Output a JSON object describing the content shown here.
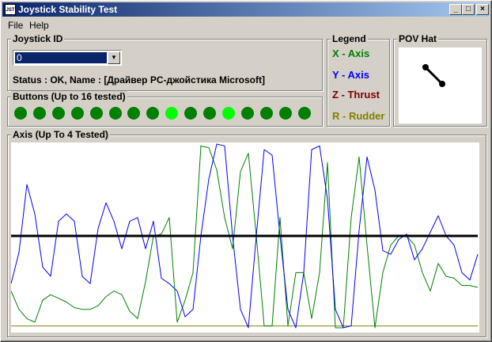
{
  "window": {
    "title": "Joystick Stability Test",
    "icon_text": "JST",
    "controls": {
      "minimize": "_",
      "maximize": "□",
      "close": "×"
    }
  },
  "menu": {
    "items": [
      "File",
      "Help"
    ]
  },
  "joystick": {
    "group_label": "Joystick ID",
    "selected_id": "0",
    "status": "Status : OK, Name : [Драйвер PC-джойстика Microsoft]"
  },
  "buttons": {
    "group_label": "Buttons  (Up to 16 tested)",
    "states": [
      false,
      false,
      false,
      false,
      false,
      false,
      false,
      false,
      true,
      false,
      false,
      true,
      false,
      false,
      false,
      false
    ],
    "colors": {
      "off": "#008000",
      "on": "#00ff00"
    }
  },
  "legend": {
    "group_label": "Legend",
    "items": [
      {
        "label": "X - Axis",
        "color": "#008000"
      },
      {
        "label": "Y - Axis",
        "color": "#0000ff"
      },
      {
        "label": "Z - Thrust",
        "color": "#800000"
      },
      {
        "label": "R - Rudder",
        "color": "#808000"
      }
    ]
  },
  "pov": {
    "group_label": "POV Hat",
    "direction": "northwest"
  },
  "axis": {
    "group_label": "Axis (Up To 4 Tested)"
  },
  "chart_data": {
    "type": "line",
    "title": "",
    "xlabel": "",
    "ylabel": "",
    "ylim": [
      0,
      1
    ],
    "x": [
      0,
      10,
      20,
      30,
      40,
      50,
      60,
      70,
      80,
      90,
      100,
      110,
      120,
      130,
      140,
      150,
      160,
      170,
      180,
      190,
      200,
      210,
      220,
      230,
      240,
      250,
      260,
      270,
      280,
      290,
      300,
      310,
      320,
      330,
      340,
      350,
      360,
      370,
      380,
      390,
      400,
      410,
      420,
      430,
      440,
      450,
      460,
      470,
      480,
      490,
      500,
      510,
      520,
      530,
      540,
      550,
      560,
      570,
      580,
      590
    ],
    "series": [
      {
        "name": "X - Axis",
        "color": "#008000",
        "values": [
          0.2,
          0.1,
          0.05,
          0.03,
          0.15,
          0.18,
          0.16,
          0.14,
          0.11,
          0.1,
          0.1,
          0.12,
          0.17,
          0.2,
          0.18,
          0.09,
          0.05,
          0.25,
          0.5,
          0.51,
          0.6,
          0.03,
          0.15,
          0.3,
          0.99,
          0.98,
          0.86,
          0.6,
          0.43,
          0.85,
          0.95,
          0.5,
          0.01,
          0.01,
          0.6,
          0.01,
          0.3,
          0.3,
          0.05,
          0.3,
          0.9,
          0.0,
          0.0,
          0.6,
          0.93,
          0.45,
          0.0,
          0.3,
          0.45,
          0.5,
          0.5,
          0.45,
          0.3,
          0.2,
          0.35,
          0.28,
          0.27,
          0.23,
          0.23,
          0.22
        ]
      },
      {
        "name": "Y - Axis",
        "color": "#0000ff",
        "values": [
          0.24,
          0.41,
          0.78,
          0.62,
          0.33,
          0.28,
          0.58,
          0.62,
          0.58,
          0.28,
          0.24,
          0.54,
          0.68,
          0.58,
          0.43,
          0.58,
          0.6,
          0.43,
          0.58,
          0.27,
          0.24,
          0.2,
          0.06,
          0.1,
          0.5,
          0.81,
          1.0,
          0.99,
          0.5,
          0.1,
          0.0,
          0.5,
          0.97,
          0.94,
          0.5,
          0.1,
          0.0,
          0.3,
          0.97,
          0.99,
          0.7,
          0.1,
          0.0,
          0.01,
          0.53,
          0.93,
          0.75,
          0.42,
          0.4,
          0.48,
          0.51,
          0.37,
          0.43,
          0.52,
          0.61,
          0.5,
          0.45,
          0.3,
          0.26,
          0.4
        ]
      },
      {
        "name": "Z - Thrust",
        "color": "#800000",
        "values": [
          0.5,
          0.5,
          0.5,
          0.5,
          0.5,
          0.5,
          0.5,
          0.5,
          0.5,
          0.5,
          0.5,
          0.5,
          0.5,
          0.5,
          0.5,
          0.5,
          0.5,
          0.5,
          0.5,
          0.5,
          0.5,
          0.5,
          0.5,
          0.5,
          0.5,
          0.5,
          0.5,
          0.5,
          0.5,
          0.5,
          0.5,
          0.5,
          0.5,
          0.5,
          0.5,
          0.5,
          0.5,
          0.5,
          0.5,
          0.5,
          0.5,
          0.5,
          0.5,
          0.5,
          0.5,
          0.5,
          0.5,
          0.5,
          0.5,
          0.5,
          0.5,
          0.5,
          0.5,
          0.5,
          0.5,
          0.5,
          0.5,
          0.5,
          0.5,
          0.5
        ]
      },
      {
        "name": "R - Rudder",
        "color": "#808000",
        "values": [
          0.01,
          0.01,
          0.01,
          0.01,
          0.01,
          0.01,
          0.01,
          0.01,
          0.01,
          0.01,
          0.01,
          0.01,
          0.01,
          0.01,
          0.01,
          0.01,
          0.01,
          0.01,
          0.01,
          0.01,
          0.01,
          0.01,
          0.01,
          0.01,
          0.01,
          0.01,
          0.01,
          0.01,
          0.01,
          0.01,
          0.01,
          0.01,
          0.01,
          0.01,
          0.01,
          0.01,
          0.01,
          0.01,
          0.01,
          0.01,
          0.01,
          0.01,
          0.01,
          0.01,
          0.01,
          0.01,
          0.01,
          0.01,
          0.01,
          0.01,
          0.01,
          0.01,
          0.01,
          0.01,
          0.01,
          0.01,
          0.01,
          0.01,
          0.01,
          0.01
        ]
      }
    ],
    "grid": false,
    "legend": "external"
  }
}
